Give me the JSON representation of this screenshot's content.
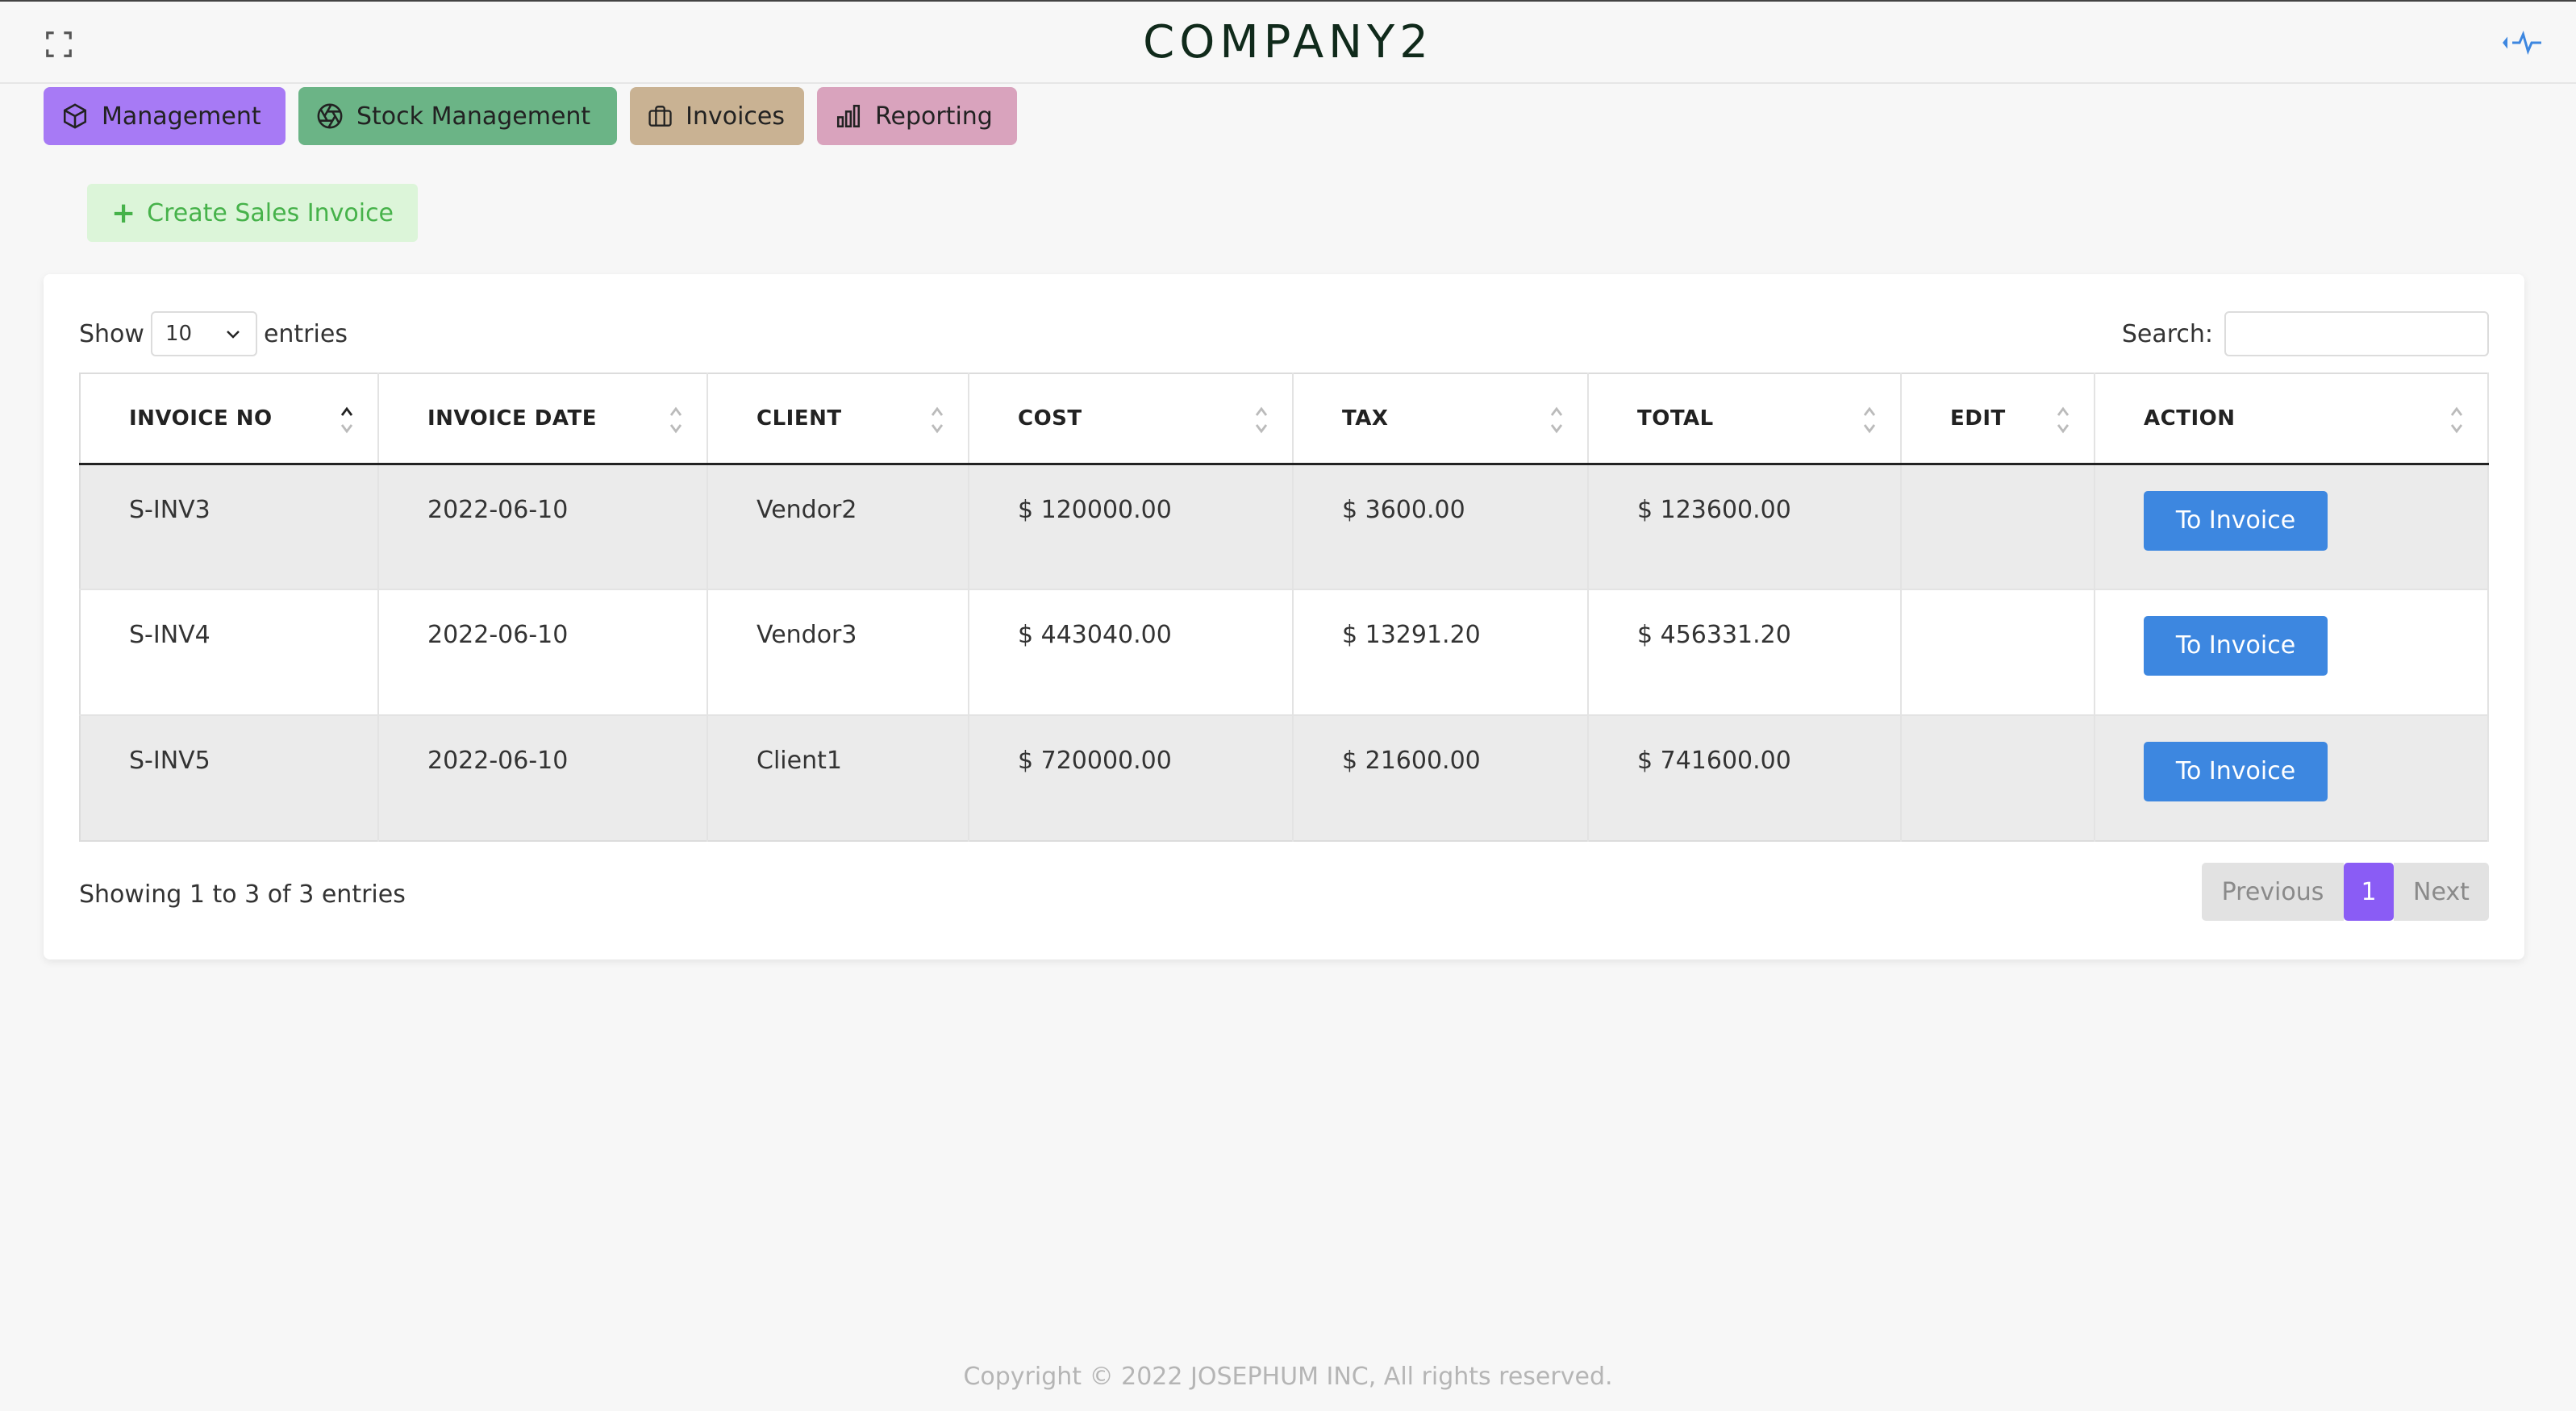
{
  "header": {
    "brand": "COMPANY2"
  },
  "modules": [
    {
      "label": "Management",
      "icon": "cube-icon",
      "color": "#a77af5"
    },
    {
      "label": "Stock Management",
      "icon": "aperture-icon",
      "color": "#6bb486"
    },
    {
      "label": "Invoices",
      "icon": "briefcase-icon",
      "color": "#c9b293"
    },
    {
      "label": "Reporting",
      "icon": "bar-chart-icon",
      "color": "#d9a3bd"
    }
  ],
  "create_button": {
    "label": "Create Sales Invoice"
  },
  "table_controls": {
    "show_label": "Show",
    "entries_label": "entries",
    "page_length": "10",
    "search_label": "Search:",
    "search_value": ""
  },
  "table": {
    "columns": [
      "INVOICE NO",
      "INVOICE DATE",
      "CLIENT",
      "COST",
      "TAX",
      "TOTAL",
      "EDIT",
      "ACTION"
    ],
    "rows": [
      {
        "invoice_no": "S-INV3",
        "date": "2022-06-10",
        "client": "Vendor2",
        "cost": "$ 120000.00",
        "tax": "$ 3600.00",
        "total": "$ 123600.00",
        "edit": "",
        "action": "To Invoice"
      },
      {
        "invoice_no": "S-INV4",
        "date": "2022-06-10",
        "client": "Vendor3",
        "cost": "$ 443040.00",
        "tax": "$ 13291.20",
        "total": "$ 456331.20",
        "edit": "",
        "action": "To Invoice"
      },
      {
        "invoice_no": "S-INV5",
        "date": "2022-06-10",
        "client": "Client1",
        "cost": "$ 720000.00",
        "tax": "$ 21600.00",
        "total": "$ 741600.00",
        "edit": "",
        "action": "To Invoice"
      }
    ]
  },
  "info": "Showing 1 to 3 of 3 entries",
  "pagination": {
    "previous": "Previous",
    "current": "1",
    "next": "Next"
  },
  "footer": "Copyright © 2022  JOSEPHUM INC, All rights reserved.",
  "colors": {
    "accent": "#8a5cf5",
    "action_button": "#3d87e0",
    "create_text": "#46b24a"
  }
}
